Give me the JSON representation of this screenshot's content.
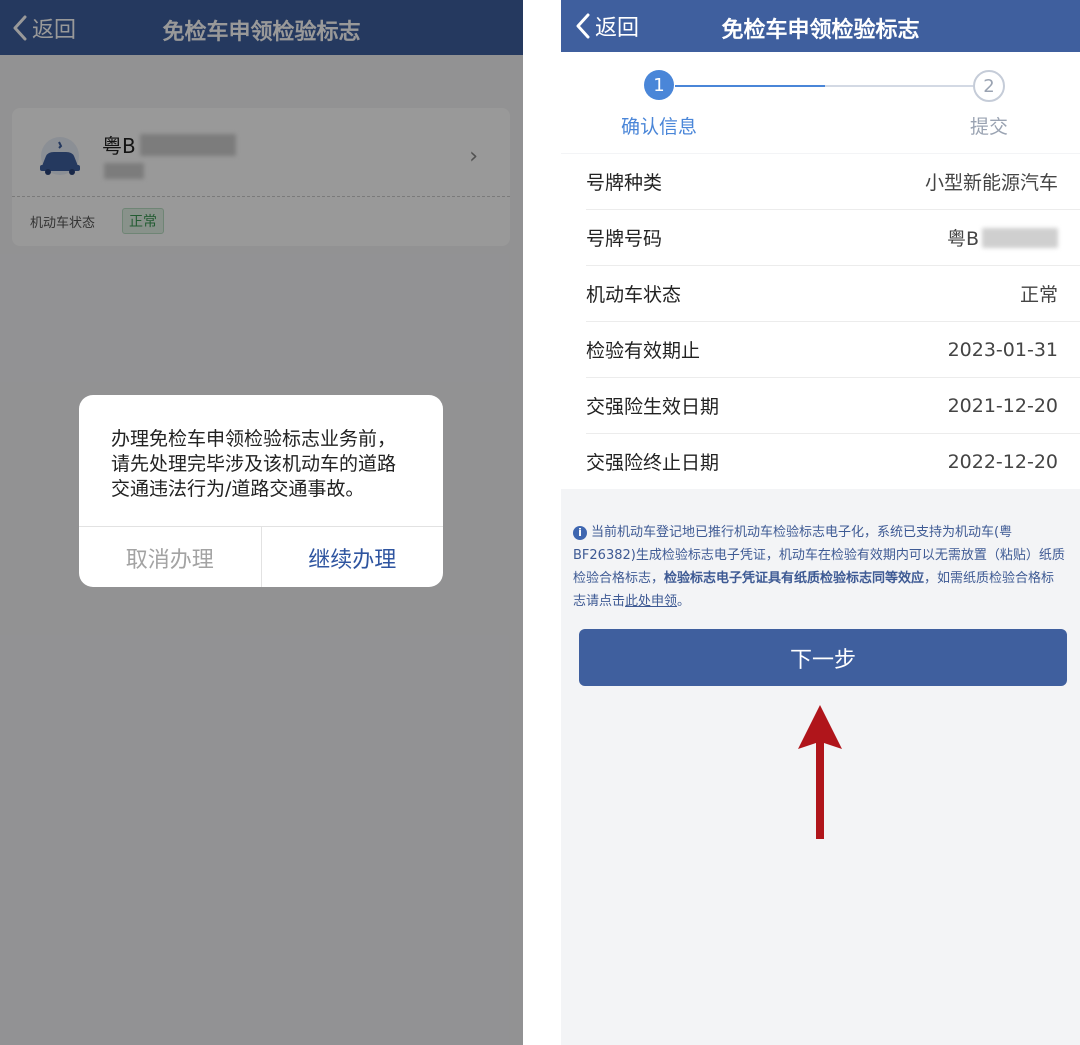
{
  "left": {
    "nav": {
      "back": "返回",
      "title": "免检车申领检验标志"
    },
    "card": {
      "plate_prefix": "粤B",
      "status_label": "机动车状态",
      "status_value": "正常"
    },
    "dialog": {
      "message": "办理免检车申领检验标志业务前，请先处理完毕涉及该机动车的道路交通违法行为/道路交通事故。",
      "cancel": "取消办理",
      "continue": "继续办理"
    }
  },
  "right": {
    "nav": {
      "back": "返回",
      "title": "免检车申领检验标志"
    },
    "steps": [
      {
        "num": "1",
        "label": "确认信息"
      },
      {
        "num": "2",
        "label": "提交"
      }
    ],
    "rows": [
      {
        "label": "号牌种类",
        "value": "小型新能源汽车"
      },
      {
        "label": "号牌号码",
        "value": "粤B"
      },
      {
        "label": "机动车状态",
        "value": "正常"
      },
      {
        "label": "检验有效期止",
        "value": "2023-01-31"
      },
      {
        "label": "交强险生效日期",
        "value": "2021-12-20"
      },
      {
        "label": "交强险终止日期",
        "value": "2022-12-20"
      }
    ],
    "notice": {
      "part1": "当前机动车登记地已推行机动车检验标志电子化，系统已支持为机动车(粤BF26382)生成检验标志电子凭证，机动车在检验有效期内可以无需放置（粘贴）纸质检验合格标志，",
      "bold": "检验标志电子凭证具有纸质检验标志同等效应",
      "part2": "，如需纸质检验合格标志请点击",
      "link": "此处申领",
      "end": "。"
    },
    "next_button": "下一步"
  },
  "colors": {
    "nav_bg": "#3f5f9e",
    "accent": "#4a86d8",
    "arrow": "#b0151b"
  }
}
